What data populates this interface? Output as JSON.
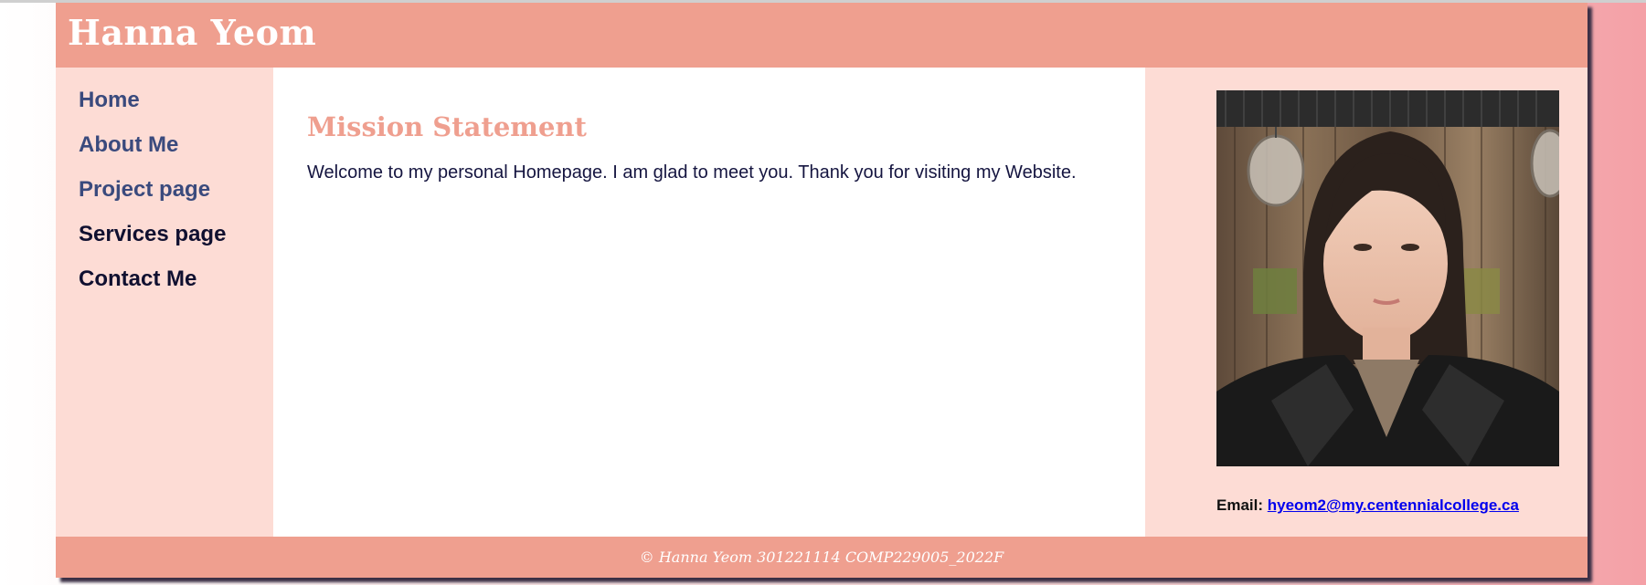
{
  "header": {
    "site_title": "Hanna Yeom"
  },
  "nav": {
    "items": [
      {
        "label": "Home"
      },
      {
        "label": "About Me"
      },
      {
        "label": "Project page"
      },
      {
        "label": "Services page"
      },
      {
        "label": "Contact Me"
      }
    ]
  },
  "main": {
    "heading": "Mission Statement",
    "paragraph": "Welcome to my personal Homepage. I am glad to meet you. Thank you for visiting my Website."
  },
  "aside": {
    "email_label": "Email:",
    "email_address": "hyeom2@my.centennialcollege.ca"
  },
  "footer": {
    "text": "© Hanna Yeom 301221114 COMP229005_2022F"
  },
  "colors": {
    "header_bg": "#ef9f8f",
    "panel_bg": "#fddcd5",
    "nav_link": "#3a4a7d",
    "nav_link_active": "#101030",
    "heading": "#ef9f8f",
    "link": "#0000ee"
  }
}
